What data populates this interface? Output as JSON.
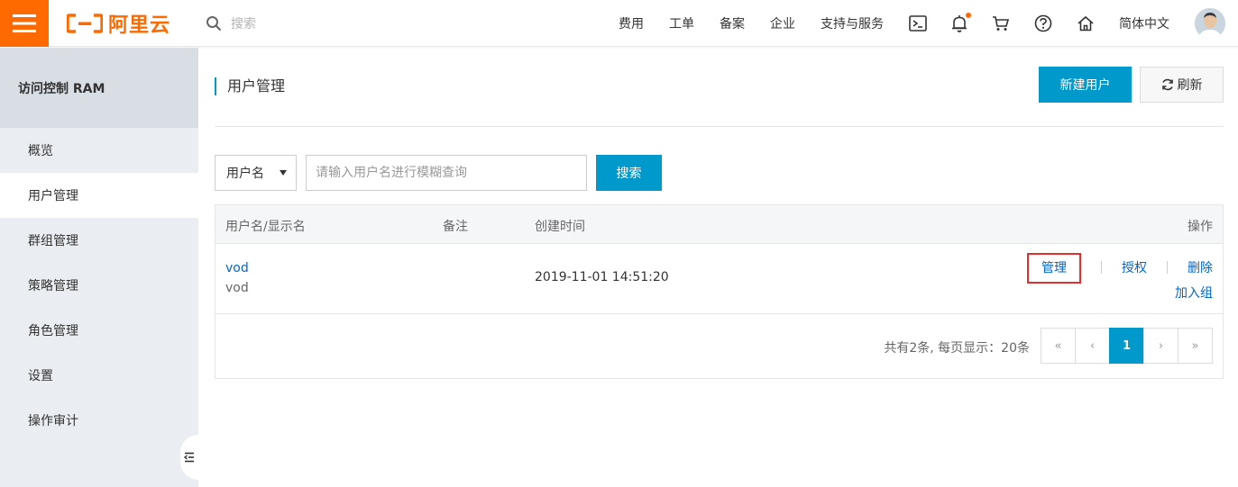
{
  "brand": {
    "logo_text": "阿里云",
    "accent": "#ff6a00"
  },
  "topbar": {
    "search_placeholder": "搜索",
    "nav": [
      "费用",
      "工单",
      "备案",
      "企业",
      "支持与服务"
    ],
    "language": "简体中文"
  },
  "sidebar": {
    "title": "访问控制 RAM",
    "items": [
      "概览",
      "用户管理",
      "群组管理",
      "策略管理",
      "角色管理",
      "设置",
      "操作审计"
    ],
    "active_index": 1
  },
  "main": {
    "title": "用户管理",
    "new_user_label": "新建用户",
    "refresh_label": "刷新",
    "filter": {
      "select_value": "用户名",
      "input_placeholder": "请输入用户名进行模糊查询",
      "search_label": "搜索"
    },
    "table": {
      "columns": [
        "用户名/显示名",
        "备注",
        "创建时间",
        "操作"
      ],
      "rows": [
        {
          "username": "vod",
          "display_name": "vod",
          "note": "",
          "created": "2019-11-01 14:51:20",
          "actions": [
            "管理",
            "授权",
            "删除",
            "加入组"
          ]
        }
      ]
    },
    "pagination": {
      "summary": "共有2条, 每页显示：20条",
      "first": "«",
      "prev": "‹",
      "current": "1",
      "next": "›",
      "last": "»"
    }
  },
  "colors": {
    "primary": "#0099cc",
    "link": "#0066cc",
    "highlight": "#e03030"
  }
}
